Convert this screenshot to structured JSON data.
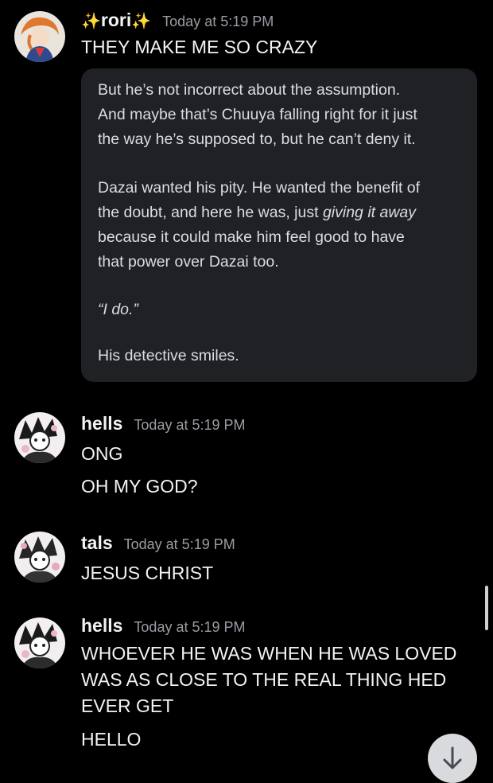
{
  "messages": [
    {
      "author": "rori",
      "author_decoration": "sparkles-icon",
      "timestamp": "Today at 5:19 PM",
      "lines": [
        "THEY MAKE ME SO CRAZY"
      ],
      "embed": {
        "lines": [
          "But he’s not incorrect about the assumption.",
          "And maybe that’s Chuuya falling right for it just",
          "the way he’s supposed to, but he can’t deny it.",
          "Dazai wanted his pity. He wanted the benefit of",
          "the doubt, and here he was, just ",
          "giving it away",
          "because it could make him feel good to have",
          "that power over Dazai too.",
          "“I do.”",
          "His detective smiles."
        ]
      }
    },
    {
      "author": "hells",
      "timestamp": "Today at 5:19 PM",
      "lines": [
        "ONG",
        "OH MY GOD?"
      ]
    },
    {
      "author": "tals",
      "timestamp": "Today at 5:19 PM",
      "lines": [
        "JESUS CHRIST"
      ]
    },
    {
      "author": "hells",
      "timestamp": "Today at 5:19 PM",
      "lines": [
        "WHOEVER HE WAS WHEN HE WAS LOVED",
        "WAS AS CLOSE TO THE REAL THING HED",
        "EVER GET",
        "HELLO"
      ]
    }
  ],
  "controls": {
    "jump_to_present_icon": "arrow-down-icon"
  },
  "colors": {
    "background": "#000000",
    "embed_background": "#202125",
    "timestamp": "#9a9ca3",
    "sparkle": "#f6c445"
  }
}
